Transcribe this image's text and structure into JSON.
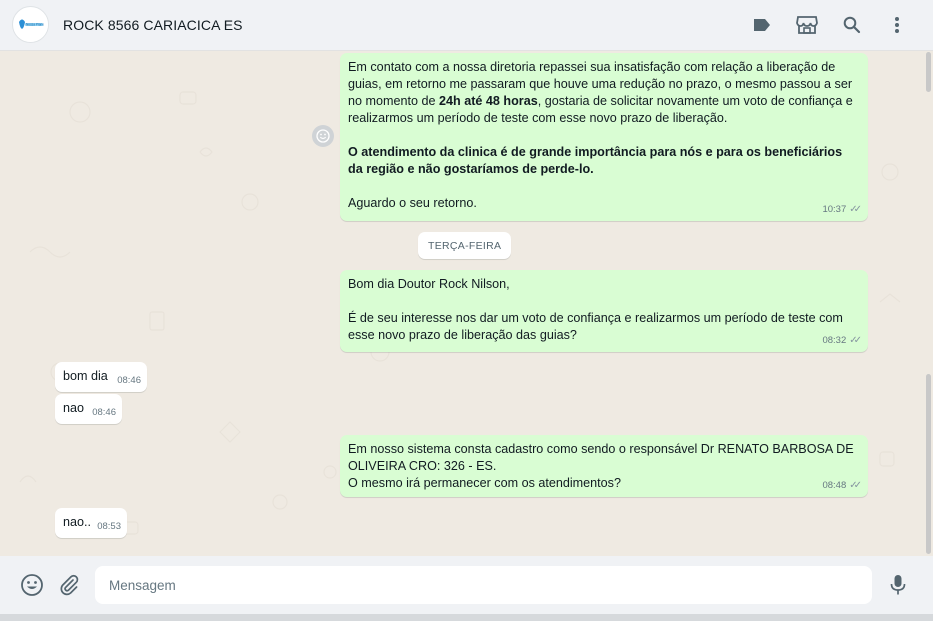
{
  "header": {
    "avatar_label": "Nossa Plano",
    "contact_name": "ROCK 8566 CARIACICA ES",
    "icons": [
      "label-icon",
      "catalog-icon",
      "search-icon",
      "menu-icon"
    ]
  },
  "messages": {
    "m1": {
      "p1_a": "Em contato com a nossa diretoria repassei sua insatisfação com relação a liberação de guias, em retorno me passaram que houve uma redução no prazo, o mesmo passou a ser no momento de ",
      "p1_bold": "24h até 48 horas",
      "p1_b": ", gostaria de solicitar novamente um voto de confiança e realizarmos um período de teste com esse novo prazo de liberação.",
      "p2_bold": "O atendimento da clinica é de grande importância para nós e para os beneficiários da região e não gostaríamos de perde-lo.",
      "p3": "Aguardo o seu retorno.",
      "time": "10:37"
    },
    "day_divider": "TERÇA-FEIRA",
    "m2": {
      "text": "Bom dia Doutor Rock Nilson,\n\nÉ de seu interesse nos dar um voto de confiança e realizarmos um período de teste com esse novo prazo de liberação das guias?",
      "time": "08:32"
    },
    "m3": {
      "text": "bom dia",
      "time": "08:46"
    },
    "m4": {
      "text": "nao",
      "time": "08:46"
    },
    "m5": {
      "text": "Em nosso sistema consta cadastro como sendo o responsável Dr RENATO BARBOSA DE OLIVEIRA CRO: 326 - ES.\nO mesmo irá permanecer com os atendimentos?",
      "time": "08:48"
    },
    "m6": {
      "text": "nao..",
      "time": "08:53"
    }
  },
  "composer": {
    "placeholder": "Mensagem",
    "icons": [
      "emoji-icon",
      "attach-icon",
      "microphone-icon"
    ]
  },
  "colors": {
    "outgoing_bubble": "#d9fdd3",
    "incoming_bubble": "#ffffff",
    "chat_background": "#efeae2",
    "header_background": "#f0f2f5"
  }
}
